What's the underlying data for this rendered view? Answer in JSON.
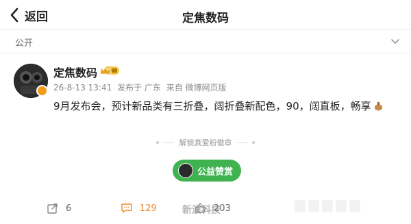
{
  "header": {
    "back_label": "返回",
    "title": "定焦数码"
  },
  "visibility": {
    "label": "公开"
  },
  "post": {
    "author": "定焦数码",
    "timestamp": "26-8-13 13:41",
    "location": "发布于 广东",
    "source": "来自 微博网页版",
    "text": "9月发布会，预计新品类有三折叠，阔折叠新配色，90，阔直板，畅享"
  },
  "badge_section": {
    "label": "解锁真爱粉徽章"
  },
  "charity": {
    "label": "公益赞赏"
  },
  "actions": {
    "repost_count": "6",
    "comment_count": "129",
    "like_count": "203"
  },
  "watermark": "新浪科技",
  "colors": {
    "accent_green": "#3fb34f",
    "comment_orange": "#f08a24",
    "vip_gold": "#f4c542"
  }
}
